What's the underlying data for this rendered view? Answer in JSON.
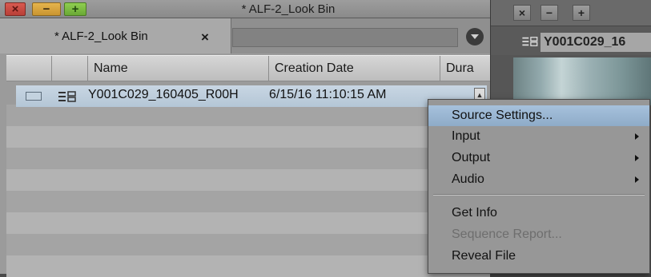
{
  "window": {
    "title": "* ALF-2_Look Bin",
    "close": "×",
    "minimize": "−",
    "maximize": "+"
  },
  "tab": {
    "label": "* ALF-2_Look Bin",
    "close": "×"
  },
  "columns": [
    "Name",
    "Creation Date",
    "Dura"
  ],
  "clip": {
    "name": "Y001C029_160405_R00H",
    "creation_date": "6/15/16 11:10:15 AM"
  },
  "right_panel": {
    "buttons": [
      "×",
      "−",
      "+"
    ],
    "clip_name": "Y001C029_16"
  },
  "context_menu": {
    "items": [
      {
        "label": "Source Settings...",
        "highlighted": true,
        "submenu": false,
        "disabled": false
      },
      {
        "label": "Input",
        "submenu": true,
        "disabled": false
      },
      {
        "label": "Output",
        "submenu": true,
        "disabled": false
      },
      {
        "label": "Audio",
        "submenu": true,
        "disabled": false
      },
      {
        "label": "Get Info",
        "submenu": false,
        "disabled": false
      },
      {
        "label": "Sequence Report...",
        "submenu": false,
        "disabled": true
      },
      {
        "label": "Reveal File",
        "submenu": false,
        "disabled": false
      }
    ]
  },
  "colors": {
    "highlight": "#9db8d3",
    "selection": "#bccbda",
    "close": "#c6473f",
    "minimize": "#d9a43e",
    "maximize": "#7dbd44"
  }
}
